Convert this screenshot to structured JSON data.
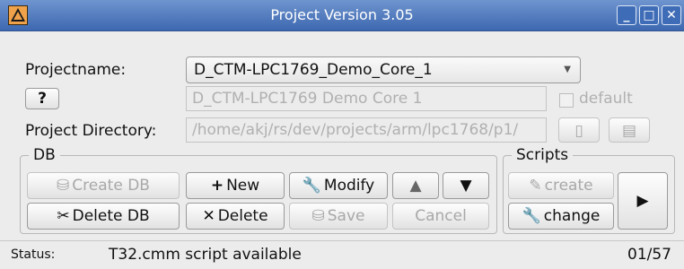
{
  "window": {
    "title": "Project Version 3.05"
  },
  "form": {
    "projectname_label": "Projectname:",
    "projectname_value": "D_CTM-LPC1769_Demo_Core_1",
    "help_label": "?",
    "description_value": "D_CTM-LPC1769 Demo Core 1",
    "default_label": "default",
    "directory_label": "Project Directory:",
    "directory_value": "/home/akj/rs/dev/projects/arm/lpc1768/p1/"
  },
  "db": {
    "title": "DB",
    "create_db": "Create DB",
    "delete_db": "Delete DB",
    "new": "New",
    "delete": "Delete",
    "modify": "Modify",
    "save": "Save",
    "up": "▲",
    "down": "▼",
    "cancel": "Cancel"
  },
  "scripts": {
    "title": "Scripts",
    "create": "create",
    "change": "change",
    "run": "▶"
  },
  "status": {
    "label": "Status:",
    "message": "T32.cmm script available",
    "counter": "01/57"
  },
  "icons": {
    "app": "app-icon",
    "create_db": "database-icon",
    "delete_db": "scissors-icon",
    "new": "plus-icon",
    "delete": "x-icon",
    "modify": "wrench-icon",
    "save": "save-icon",
    "create_script": "script-icon",
    "change_script": "wrench-icon",
    "browse_folder": "folder-icon",
    "browse_list": "list-icon"
  }
}
